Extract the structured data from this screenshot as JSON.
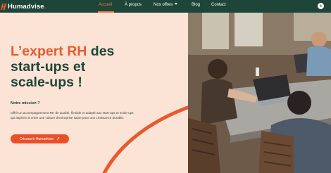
{
  "brand": {
    "name": "Humadvise",
    "dot": ".",
    "logo_color": "#e85a2d"
  },
  "nav": {
    "items": [
      {
        "label": "Accueil",
        "active": true
      },
      {
        "label": "À propos"
      },
      {
        "label": "Nos offres"
      },
      {
        "label": "Blog"
      },
      {
        "label": "Contact"
      }
    ],
    "lang": "fr"
  },
  "hero": {
    "title_accent": "L’expert RH",
    "title_line1_rest": " des",
    "title_line2": "start-ups et",
    "title_line3": "scale-ups !",
    "mission_label": "Notre mission ?",
    "mission_text": "Offrir un accompagnement RH de qualité, flexible et adapté aux start-ups et scale-ups qui aspirent à créer une culture d'entreprise saine pour une croissance durable.",
    "cta_label": "Découvrir Humadvise"
  },
  "colors": {
    "nav_bg": "#1e4638",
    "accent": "#e85a2d",
    "page_bg": "#fbe3d6",
    "title": "#1e4638"
  }
}
